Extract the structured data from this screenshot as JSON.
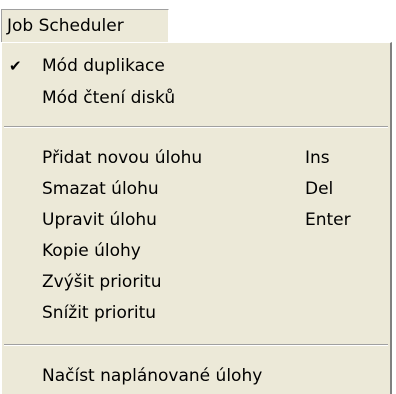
{
  "menubar": {
    "title": "Job Scheduler"
  },
  "menu": {
    "items": [
      {
        "label": "Mód duplikace",
        "checked": true,
        "check_glyph": "✔"
      },
      {
        "label": "Mód čtení disků"
      },
      {
        "label": "Přidat novou úlohu",
        "shortcut": "Ins"
      },
      {
        "label": "Smazat úlohu",
        "shortcut": "Del"
      },
      {
        "label": "Upravit úlohu",
        "shortcut": "Enter"
      },
      {
        "label": "Kopie úlohy"
      },
      {
        "label": "Zvýšit prioritu"
      },
      {
        "label": "Snížit prioritu"
      },
      {
        "label": "Načíst naplánované úlohy"
      }
    ]
  },
  "colors": {
    "menu_background": "#ece9d8",
    "separator": "#a0a0a0"
  }
}
